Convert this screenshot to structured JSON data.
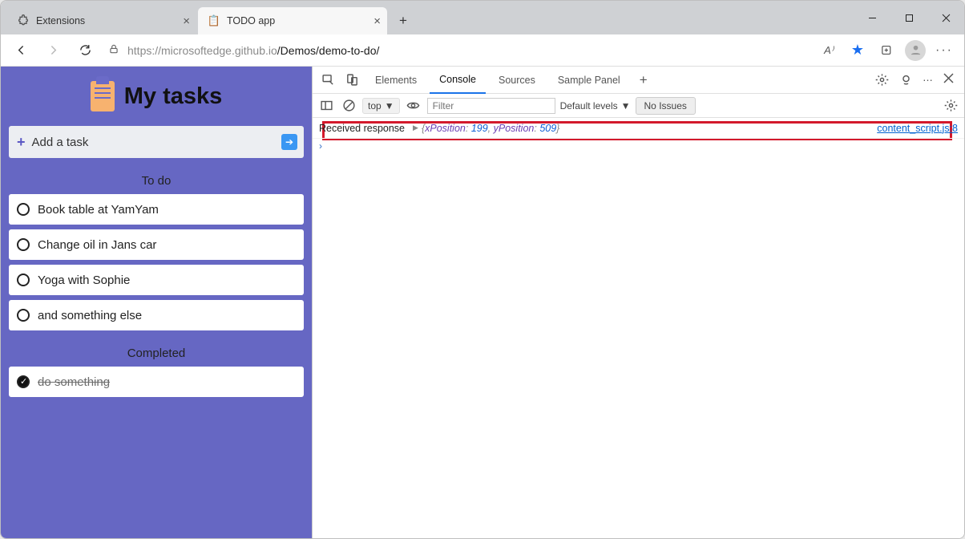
{
  "tabs": [
    {
      "title": "Extensions",
      "fav": "⚙"
    },
    {
      "title": "TODO app",
      "fav": "📋"
    }
  ],
  "url": {
    "host": "https://microsoftedge.github.io",
    "path": "/Demos/demo-to-do/"
  },
  "todo": {
    "heading": "My tasks",
    "add_placeholder": "Add a task",
    "section_todo": "To do",
    "section_done": "Completed",
    "items": [
      {
        "text": "Book table at YamYam"
      },
      {
        "text": "Change oil in Jans car"
      },
      {
        "text": "Yoga with Sophie"
      },
      {
        "text": "and something else"
      }
    ],
    "done": [
      {
        "text": "do something"
      }
    ]
  },
  "devtools": {
    "tabs": {
      "elements": "Elements",
      "console": "Console",
      "sources": "Sources",
      "sample": "Sample Panel"
    },
    "context": "top",
    "filter_placeholder": "Filter",
    "levels": "Default levels",
    "issues": "No Issues",
    "log": {
      "msg": "Received response",
      "obj_open": "{",
      "k1": "xPosition",
      "v1": "199",
      "k2": "yPosition",
      "v2": "509",
      "obj_close": "}",
      "source": "content_script.js:8"
    }
  }
}
